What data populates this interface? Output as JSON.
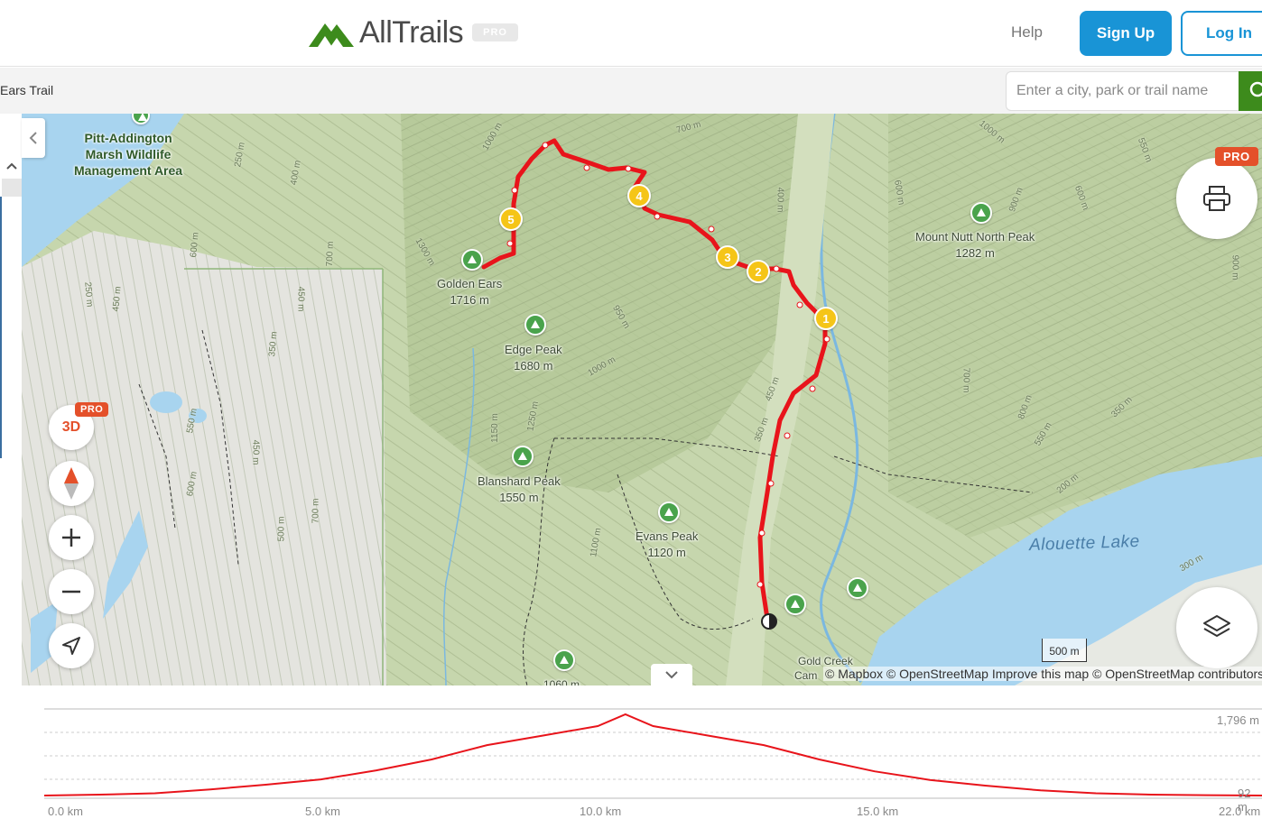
{
  "header": {
    "logo_text": "AllTrails",
    "pro_label": "PRO",
    "help_label": "Help",
    "signup_label": "Sign Up",
    "login_label": "Log In"
  },
  "subbar": {
    "breadcrumb": "Ears Trail",
    "search_placeholder": "Enter a city, park or trail name"
  },
  "map": {
    "area_label_lines": [
      "Pitt-Addington",
      "Marsh Wildlife",
      "Management Area"
    ],
    "peaks": [
      {
        "name": "Golden Ears",
        "elev": "1716 m"
      },
      {
        "name": "Edge Peak",
        "elev": "1680 m"
      },
      {
        "name": "Blanshard Peak",
        "elev": "1550 m"
      },
      {
        "name": "Evans Peak",
        "elev": "1120 m"
      },
      {
        "name": "Mount Nutt North Peak",
        "elev": "1282 m"
      }
    ],
    "partial_labels": {
      "gold_creek": "Gold Creek",
      "camp": "Cam",
      "bottom_peak_elev": "1060 m"
    },
    "lake": "Alouette Lake",
    "waypoints": [
      "1",
      "2",
      "3",
      "4",
      "5"
    ],
    "contours": [
      "250 m",
      "400 m",
      "600 m",
      "700 m",
      "1000 m",
      "700 m",
      "400 m",
      "1000 m",
      "1300 m",
      "250 m",
      "450 m",
      "450 m",
      "350 m",
      "950 m",
      "1000 m",
      "450 m",
      "350 m",
      "1150 m",
      "1250 m",
      "1100 m",
      "550 m",
      "450 m",
      "600 m",
      "500 m",
      "700 m",
      "600 m",
      "900 m",
      "600 m",
      "550 m",
      "900 m",
      "700 m",
      "800 m",
      "550 m",
      "350 m",
      "200 m",
      "300 m"
    ],
    "controls": {
      "three_d": "3D",
      "pro": "PRO",
      "print_pro": "PRO"
    },
    "attribution": "© Mapbox © OpenStreetMap Improve this map © OpenStreetMap contributors",
    "scale": "500 m",
    "route_color": "#e8141b",
    "waypoint_color": "#f5c518",
    "accent": "#1994d6",
    "brand_green": "#3d8b1c"
  },
  "elevation": {
    "max_label": "1,796 m",
    "min_label": "92 m",
    "x_ticks": [
      "0.0 km",
      "5.0 km",
      "10.0 km",
      "15.0 km",
      "22.0 km"
    ],
    "profile_km": [
      0,
      1,
      2,
      3,
      4,
      5,
      6,
      7,
      8,
      9,
      10,
      10.5,
      11,
      12,
      13,
      14,
      15,
      16,
      17,
      18,
      19,
      20,
      21,
      22
    ],
    "profile_m": [
      92,
      110,
      140,
      220,
      320,
      430,
      620,
      850,
      1150,
      1350,
      1550,
      1796,
      1550,
      1350,
      1150,
      850,
      600,
      420,
      300,
      200,
      140,
      110,
      100,
      92
    ]
  }
}
